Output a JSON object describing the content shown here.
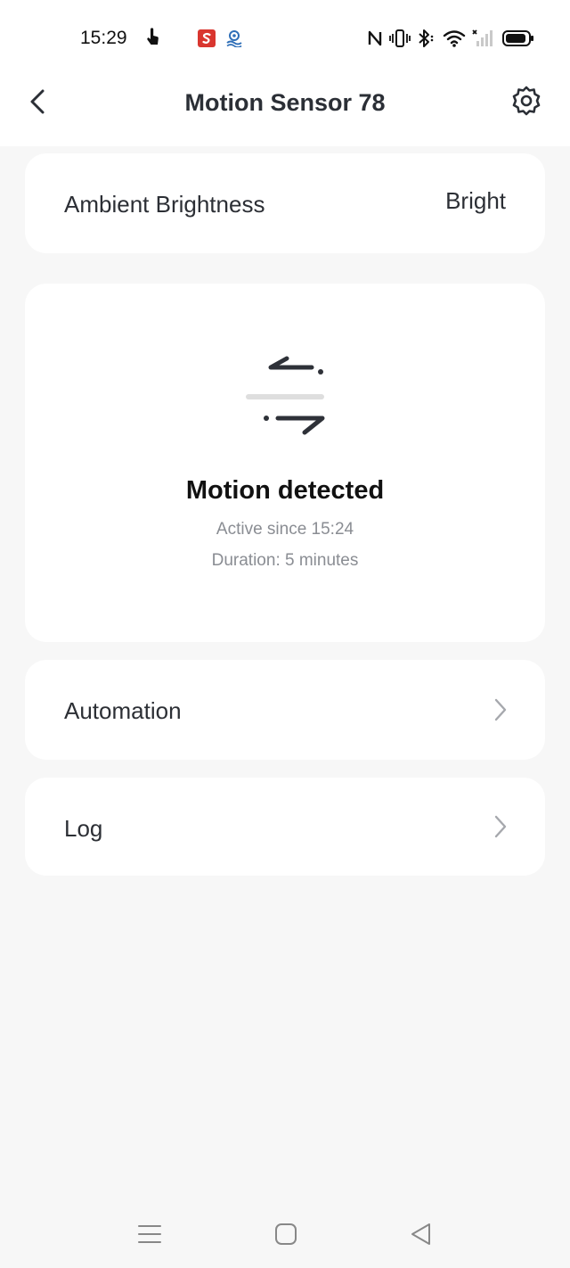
{
  "status_bar": {
    "time": "15:29"
  },
  "header": {
    "title": "Motion Sensor 78"
  },
  "brightness": {
    "label": "Ambient Brightness",
    "value": "Bright"
  },
  "motion": {
    "title": "Motion detected",
    "active_since": "Active since 15:24",
    "duration": "Duration: 5 minutes"
  },
  "automation": {
    "label": "Automation"
  },
  "log": {
    "label": "Log"
  },
  "icons": {
    "back": "chevron-left-icon",
    "settings": "gear-icon",
    "motion": "motion-arrows-icon",
    "chevron": "chevron-right-icon"
  },
  "colors": {
    "background": "#f7f7f7",
    "card": "#ffffff",
    "title_text": "#2b2f36",
    "secondary_text": "#8a8d93",
    "status_app_red": "#d9362f",
    "status_app_blue": "#2f6fb8"
  }
}
